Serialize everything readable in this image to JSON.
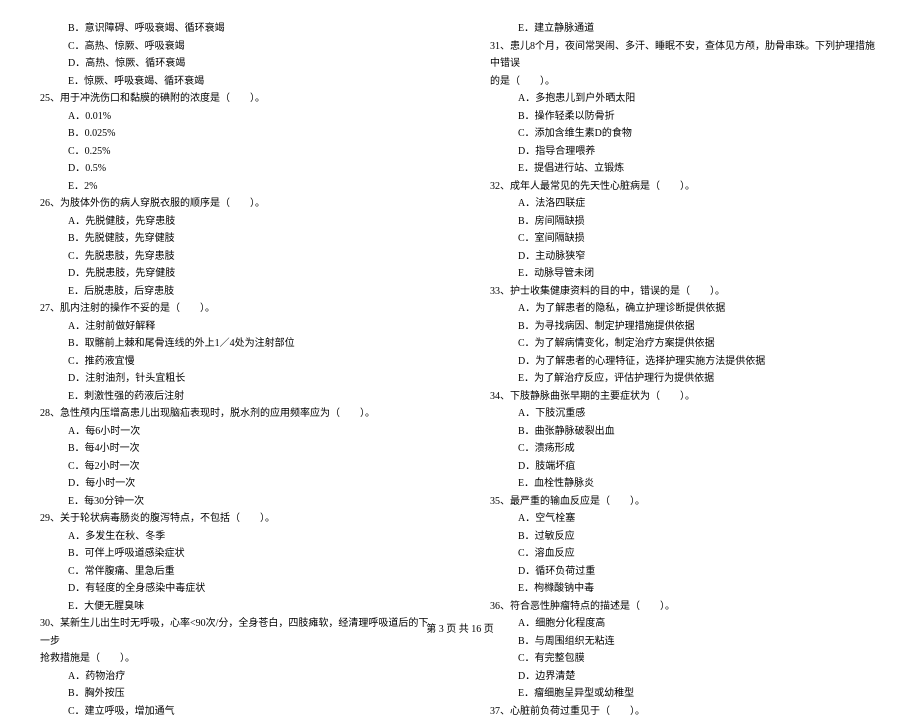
{
  "left": {
    "opts_pre": [
      "B．意识障碍、呼吸衰竭、循环衰竭",
      "C．高热、惊厥、呼吸衰竭",
      "D．高热、惊厥、循环衰竭",
      "E．惊厥、呼吸衰竭、循环衰竭"
    ],
    "q25": "25、用于冲洗伤口和黏膜的碘附的浓度是（　　）。",
    "q25_opts": [
      "A．0.01%",
      "B．0.025%",
      "C．0.25%",
      "D．0.5%",
      "E．2%"
    ],
    "q26": "26、为肢体外伤的病人穿脱衣服的顺序是（　　）。",
    "q26_opts": [
      "A．先脱健肢，先穿患肢",
      "B．先脱健肢，先穿健肢",
      "C．先脱患肢，先穿患肢",
      "D．先脱患肢，先穿健肢",
      "E．后脱患肢，后穿患肢"
    ],
    "q27": "27、肌内注射的操作不妥的是（　　）。",
    "q27_opts": [
      "A．注射前做好解释",
      "B．取髂前上棘和尾骨连线的外上1／4处为注射部位",
      "C．推药液宜慢",
      "D．注射油剂，针头宜粗长",
      "E．刺激性强的药液后注射"
    ],
    "q28": "28、急性颅内压增高患儿出现脑疝表现时，脱水剂的应用频率应为（　　）。",
    "q28_opts": [
      "A．每6小时一次",
      "B．每4小时一次",
      "C．每2小时一次",
      "D．每小时一次",
      "E．每30分钟一次"
    ],
    "q29": "29、关于轮状病毒肠炎的腹泻特点，不包括（　　）。",
    "q29_opts": [
      "A．多发生在秋、冬季",
      "B．可伴上呼吸道感染症状",
      "C．常伴腹痛、里急后重",
      "D．有轻度的全身感染中毒症状",
      "E．大便无腥臭味"
    ],
    "q30": "30、某新生儿出生时无呼吸，心率<90次/分，全身苍白，四肢瘫软，经清理呼吸道后的下一步",
    "q30_cont": "抢救措施是（　　）。",
    "q30_opts": [
      "A．药物治疗",
      "B．胸外按压",
      "C．建立呼吸，增加通气"
    ]
  },
  "right": {
    "opts_pre": [
      "E．建立静脉通道"
    ],
    "q31": "31、患儿8个月，夜间常哭闹、多汗、睡眠不安，查体见方颅，肋骨串珠。下列护理措施中错误",
    "q31_cont": "的是（　　）。",
    "q31_opts": [
      "A．多抱患儿到户外晒太阳",
      "B．操作轻柔以防骨折",
      "C．添加含维生素D的食物",
      "D．指导合理喂养",
      "E．提倡进行站、立锻炼"
    ],
    "q32": "32、成年人最常见的先天性心脏病是（　　）。",
    "q32_opts": [
      "A．法洛四联症",
      "B．房间隔缺损",
      "C．室间隔缺损",
      "D．主动脉狭窄",
      "E．动脉导管未闭"
    ],
    "q33": "33、护士收集健康资料的目的中，错误的是（　　）。",
    "q33_opts": [
      "A．为了解患者的隐私，确立护理诊断提供依据",
      "B．为寻找病因、制定护理措施提供依据",
      "C．为了解病情变化，制定治疗方案提供依据",
      "D．为了解患者的心理特征，选择护理实施方法提供依据",
      "E．为了解治疗反应，评估护理行为提供依据"
    ],
    "q34": "34、下肢静脉曲张早期的主要症状为（　　）。",
    "q34_opts": [
      "A．下肢沉重感",
      "B．曲张静脉破裂出血",
      "C．溃疡形成",
      "D．肢端坏疽",
      "E．血栓性静脉炎"
    ],
    "q35": "35、最严重的输血反应是（　　）。",
    "q35_opts": [
      "A．空气栓塞",
      "B．过敏反应",
      "C．溶血反应",
      "D．循环负荷过重",
      "E．枸橼酸钠中毒"
    ],
    "q36": "36、符合恶性肿瘤特点的描述是（　　）。",
    "q36_opts": [
      "A．细胞分化程度高",
      "B．与周围组织无粘连",
      "C．有完整包膜",
      "D．边界清楚",
      "E．瘤细胞呈异型或幼稚型"
    ],
    "q37": "37、心脏前负荷过重见于（　　）。"
  },
  "footer": "第 3 页 共 16 页"
}
